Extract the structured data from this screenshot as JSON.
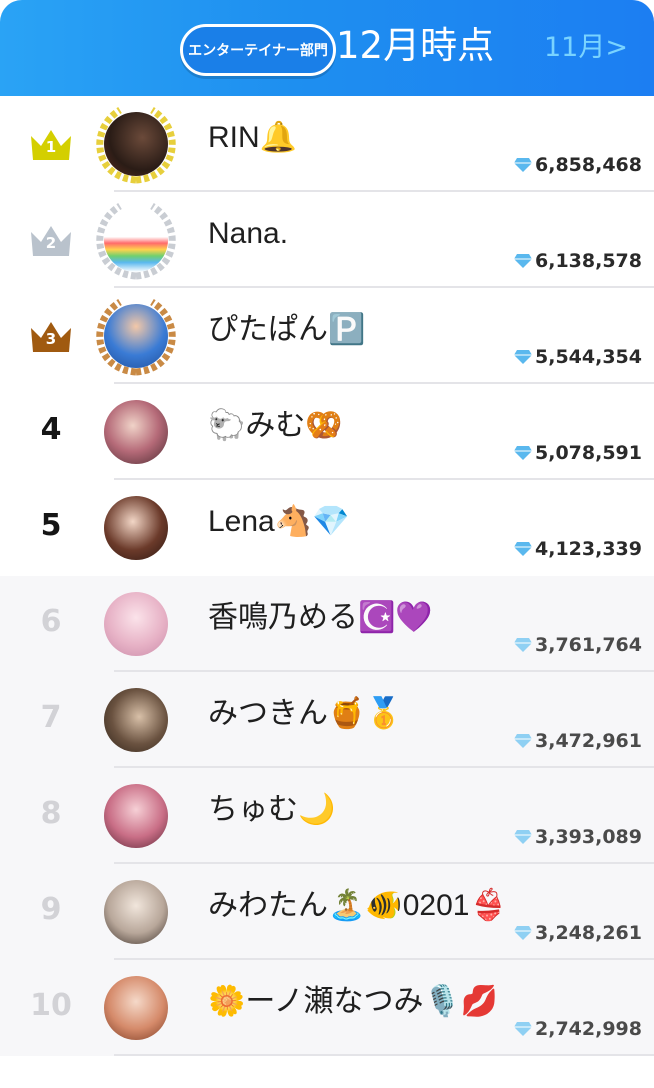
{
  "header": {
    "category_badge": "エンターテイナー部門",
    "title": "12月時点",
    "prev_month_link": "11月>"
  },
  "colors": {
    "header_blue": "#1e8ff0",
    "gold": "#d4cf00",
    "silver": "#b9c2cc",
    "bronze": "#a05a10",
    "gem": "#5ab8ee"
  },
  "ranking": [
    {
      "rank": "1",
      "name": "RIN🔔",
      "score": "6,858,468",
      "crown": "gold"
    },
    {
      "rank": "2",
      "name": "Nana.",
      "score": "6,138,578",
      "crown": "silver"
    },
    {
      "rank": "3",
      "name": "ぴたぱん🅿️",
      "score": "5,544,354",
      "crown": "bronze"
    },
    {
      "rank": "4",
      "name": "🐑みむ🥨",
      "score": "5,078,591"
    },
    {
      "rank": "5",
      "name": "Lena🐴💎",
      "score": "4,123,339"
    },
    {
      "rank": "6",
      "name": "香鳴乃める☪️💜",
      "score": "3,761,764"
    },
    {
      "rank": "7",
      "name": "みつきん🍯🥇",
      "score": "3,472,961"
    },
    {
      "rank": "8",
      "name": "ちゅむ🌙",
      "score": "3,393,089"
    },
    {
      "rank": "9",
      "name": "みわたん🏝️🐠0201👙",
      "score": "3,248,261"
    },
    {
      "rank": "10",
      "name": "🌼ーノ瀬なつみ🎙️💋",
      "score": "2,742,998"
    }
  ]
}
